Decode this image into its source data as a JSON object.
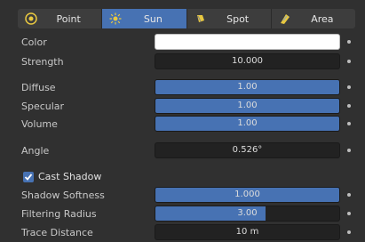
{
  "tabs": [
    {
      "label": "Point",
      "icon": "point-light-icon",
      "active": false
    },
    {
      "label": "Sun",
      "icon": "sun-light-icon",
      "active": true
    },
    {
      "label": "Spot",
      "icon": "spot-light-icon",
      "active": false
    },
    {
      "label": "Area",
      "icon": "area-light-icon",
      "active": false
    }
  ],
  "properties": {
    "color": {
      "label": "Color",
      "value": "#ffffff"
    },
    "strength": {
      "label": "Strength",
      "value": "10.000"
    },
    "diffuse": {
      "label": "Diffuse",
      "value": "1.00",
      "fill_fraction": 1.0
    },
    "specular": {
      "label": "Specular",
      "value": "1.00",
      "fill_fraction": 1.0
    },
    "volume": {
      "label": "Volume",
      "value": "1.00",
      "fill_fraction": 1.0
    },
    "angle": {
      "label": "Angle",
      "value": "0.526°"
    },
    "cast_shadow": {
      "label": "Cast Shadow",
      "checked": true
    },
    "shadow_softness": {
      "label": "Shadow Softness",
      "value": "1.000",
      "fill_fraction": 1.0
    },
    "filtering_radius": {
      "label": "Filtering Radius",
      "value": "3.00",
      "fill_fraction": 0.6
    },
    "trace_distance": {
      "label": "Trace Distance",
      "value": "10 m"
    }
  },
  "colors": {
    "accent": "#4772b3",
    "panel": "#303030",
    "field": "#222222"
  }
}
